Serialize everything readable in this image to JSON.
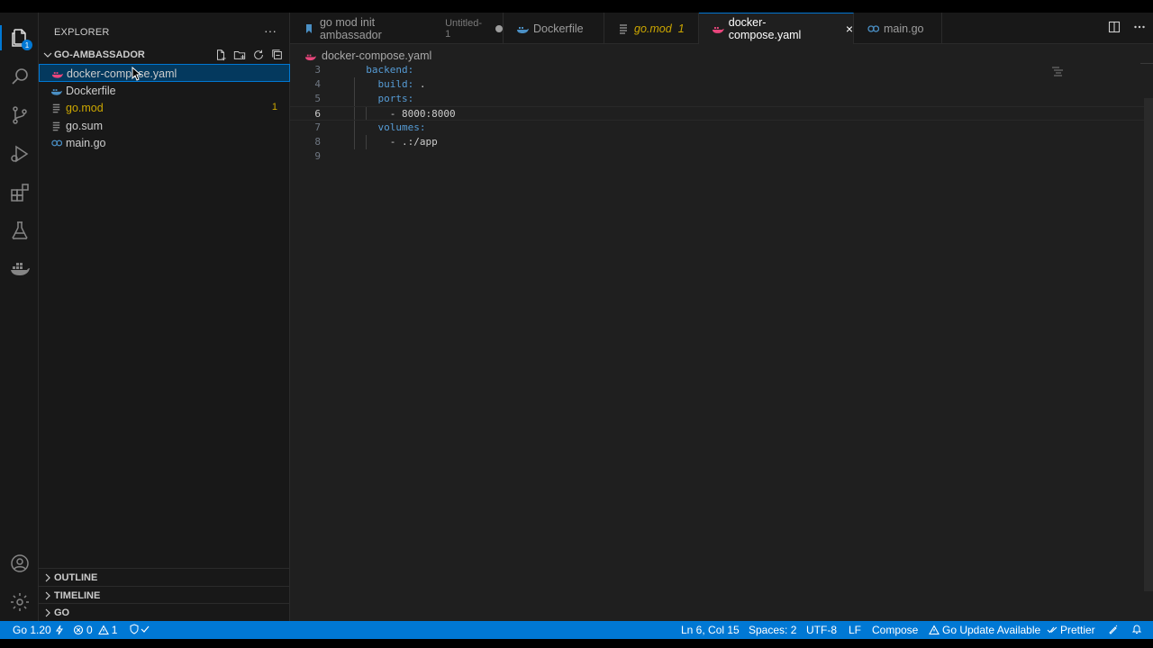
{
  "explorer": {
    "title": "EXPLORER",
    "more": "···",
    "folder": "GO-AMBASSADOR",
    "files": [
      {
        "name": "docker-compose.yaml",
        "icon": "docker-compose-icon",
        "badge": ""
      },
      {
        "name": "Dockerfile",
        "icon": "docker-icon",
        "badge": ""
      },
      {
        "name": "go.mod",
        "icon": "file-lines-icon",
        "badge": "1"
      },
      {
        "name": "go.sum",
        "icon": "file-lines-icon",
        "badge": ""
      },
      {
        "name": "main.go",
        "icon": "go-icon",
        "badge": ""
      }
    ],
    "panels": [
      "OUTLINE",
      "TIMELINE",
      "GO"
    ]
  },
  "activity": {
    "badge": "1",
    "icons": [
      "files-icon",
      "search-icon",
      "source-control-icon",
      "run-debug-icon",
      "extensions-icon",
      "testing-icon",
      "docker-icon",
      "account-icon",
      "settings-gear-icon"
    ]
  },
  "tabs": [
    {
      "label": "go mod init ambassador",
      "sub": "Untitled-1",
      "state": "dirty"
    },
    {
      "label": "Dockerfile"
    },
    {
      "label": "go.mod",
      "num": "1"
    },
    {
      "label": "docker-compose.yaml",
      "close": "×"
    },
    {
      "label": "main.go"
    }
  ],
  "editor": {
    "breadcrumb": "docker-compose.yaml",
    "lines": [
      {
        "n": "3",
        "indent": "  ",
        "key": "backend:",
        "val": ""
      },
      {
        "n": "4",
        "indent": "    ",
        "key": "build:",
        "val": " ."
      },
      {
        "n": "5",
        "indent": "    ",
        "key": "ports:",
        "val": ""
      },
      {
        "n": "6",
        "indent": "      ",
        "key": "",
        "val": "- 8000:8000"
      },
      {
        "n": "7",
        "indent": "    ",
        "key": "volumes:",
        "val": ""
      },
      {
        "n": "8",
        "indent": "      ",
        "key": "",
        "val": "- .:/app"
      },
      {
        "n": "9",
        "indent": "",
        "key": "",
        "val": ""
      }
    ],
    "current_line": "6"
  },
  "status": {
    "go_version": "Go 1.20",
    "errors": "0",
    "warnings": "1",
    "position": "Ln 6, Col 15",
    "spaces": "Spaces: 2",
    "encoding": "UTF-8",
    "eol": "LF",
    "language": "Compose",
    "update": "Go Update Available",
    "prettier": "Prettier"
  },
  "colors": {
    "accent": "#0078d4",
    "warning": "#cca700",
    "yaml_key": "#569cd6"
  }
}
